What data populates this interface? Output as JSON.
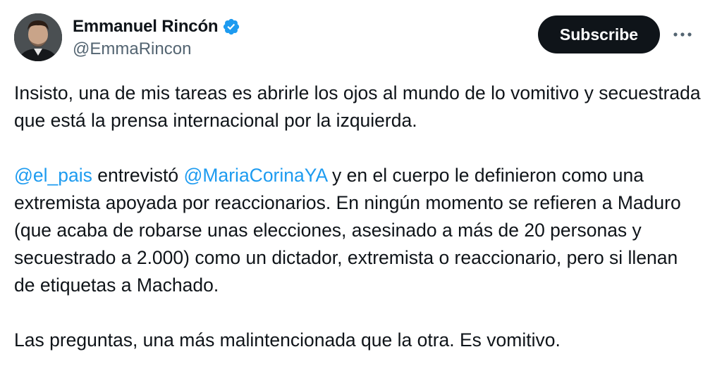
{
  "author": {
    "display_name": "Emmanuel Rincón",
    "handle": "@EmmaRincon",
    "verified": true,
    "verified_icon": "verified-badge-icon",
    "avatar_icon": "profile-photo"
  },
  "actions": {
    "subscribe_label": "Subscribe",
    "more_icon": "more-options-icon"
  },
  "tweet": {
    "paragraph1": "Insisto, una de mis tareas es abrirle los ojos al mundo de lo vomitivo y secuestrada que está la prensa internacional por la izquierda.",
    "mention1": "@el_pais",
    "text_after_mention1": " entrevistó ",
    "mention2": "@MariaCorinaYA",
    "text_after_mention2": " y en el cuerpo le definieron como una extremista apoyada por reaccionarios. En ningún momento se refieren a Maduro (que acaba de robarse unas elecciones, asesinado a más de 20 personas y secuestrado a 2.000) como un dictador, extremista o reaccionario, pero si llenan de etiquetas a Machado.",
    "paragraph3": "Las preguntas, una más malintencionada que la otra. Es vomitivo."
  },
  "colors": {
    "text": "#0f1419",
    "secondary_text": "#536471",
    "link": "#1d9bf0",
    "verified_badge": "#1d9bf0",
    "subscribe_bg": "#0f1419",
    "subscribe_text": "#ffffff"
  }
}
